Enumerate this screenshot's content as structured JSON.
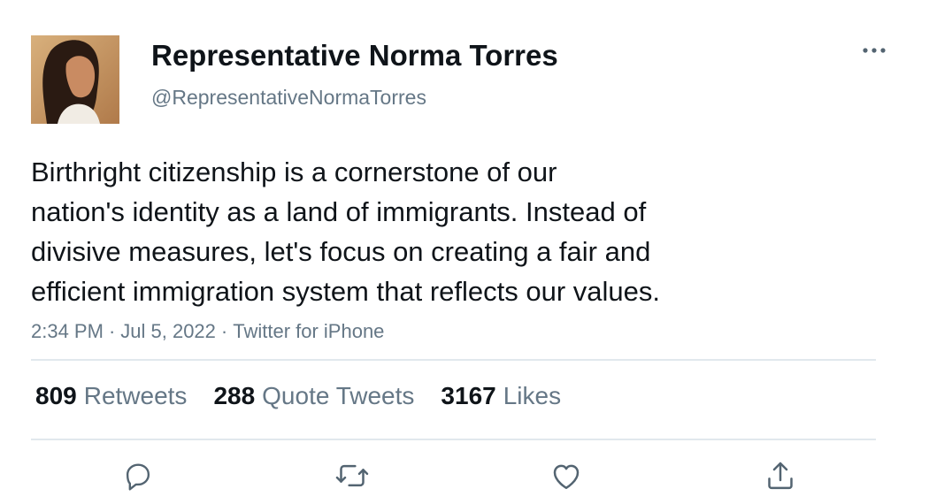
{
  "author": {
    "display_name": "Representative Norma Torres",
    "handle": "@RepresentativeNormaTorres",
    "avatar_icon": "profile-photo"
  },
  "tweet": {
    "text": "Birthright citizenship is a cornerstone of our\nnation's identity as a land of immigrants. Instead of\ndivisive measures, let's focus on creating a fair and\nefficient immigration system that reflects our values."
  },
  "meta": {
    "time": "2:34 PM",
    "separator": "·",
    "date": "Jul 5, 2022",
    "source": "Twitter for iPhone"
  },
  "stats": [
    {
      "count": "809",
      "label": "Retweets"
    },
    {
      "count": "288",
      "label": "Quote Tweets"
    },
    {
      "count": "3167",
      "label": "Likes"
    }
  ],
  "actions": [
    {
      "icon": "reply-icon"
    },
    {
      "icon": "retweet-icon"
    },
    {
      "icon": "like-icon"
    },
    {
      "icon": "share-icon"
    }
  ],
  "colors": {
    "primary_text": "#0f1419",
    "secondary_text": "#657786",
    "divider": "#e1e8ed",
    "icon": "#536471"
  }
}
